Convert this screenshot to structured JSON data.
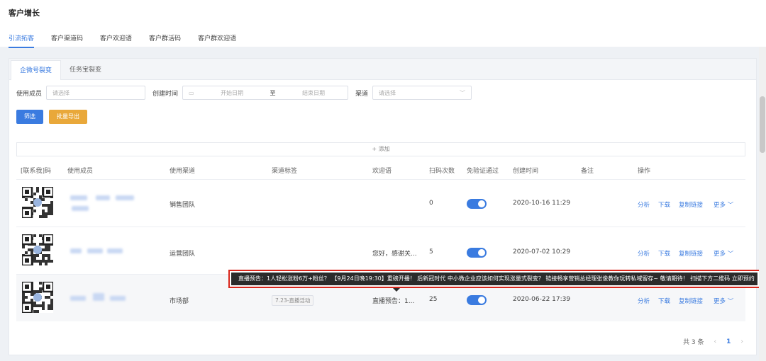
{
  "page": {
    "title": "客户增长"
  },
  "top_tabs": [
    {
      "label": "引流拓客"
    },
    {
      "label": "客户渠道码"
    },
    {
      "label": "客户欢迎语"
    },
    {
      "label": "客户群活码"
    },
    {
      "label": "客户群欢迎语"
    }
  ],
  "sub_tabs": [
    {
      "label": "企微号裂变"
    },
    {
      "label": "任务宝裂变"
    }
  ],
  "filters": {
    "member_label": "使用成员",
    "member_placeholder": "请选择",
    "time_label": "创建时间",
    "start_placeholder": "开始日期",
    "range_sep": "至",
    "end_placeholder": "结束日期",
    "channel_label": "渠道",
    "channel_placeholder": "请选择"
  },
  "buttons": {
    "filter": "筛选",
    "export": "批量导出",
    "add": "+ 添加"
  },
  "table": {
    "headers": [
      "[联系我]码",
      "使用成员",
      "使用渠道",
      "渠道标签",
      "欢迎语",
      "扫码次数",
      "免验证通过",
      "创建时间",
      "备注",
      "操作"
    ],
    "rows": [
      {
        "channel": "销售团队",
        "tag": "",
        "welcome": "",
        "scans": "0",
        "created": "2020-10-16 11:29"
      },
      {
        "channel": "运营团队",
        "tag": "",
        "welcome": "您好，感谢关...",
        "scans": "5",
        "created": "2020-07-02 10:29"
      },
      {
        "channel": "市场部",
        "tag": "7.23-直播活动",
        "welcome": "直播预告：1...",
        "scans": "25",
        "created": "2020-06-22 17:39"
      }
    ],
    "ops": {
      "analyze": "分析",
      "download": "下载",
      "copy_link": "复制链接",
      "more": "更多 ﹀"
    }
  },
  "tooltip": {
    "text": "直播预告：1人轻松涨粉6万+粉丝？ 【9月24日晚19:30】重磅开播！ 后新冠时代 中小微企业应该如何实现涨量式裂变？ 链接畅享营销总经理张俊教你玩转私域留存~ 敬请期待！ 扫描下方二维码 立即预约"
  },
  "pager": {
    "total": "共 3 条",
    "prev": "‹",
    "current": "1",
    "next": "›"
  },
  "colors": {
    "accent": "#3a7be0",
    "export": "#e9a83a",
    "highlight": "#d9261c"
  }
}
